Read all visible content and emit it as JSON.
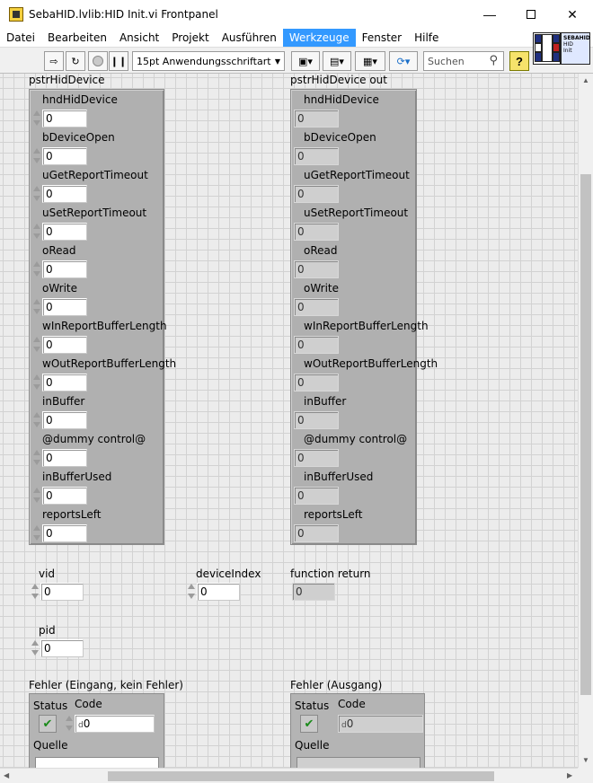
{
  "window": {
    "title": "SebaHID.lvlib:HID Init.vi Frontpanel"
  },
  "menu": [
    "Datei",
    "Bearbeiten",
    "Ansicht",
    "Projekt",
    "Ausführen",
    "Werkzeuge",
    "Fenster",
    "Hilfe"
  ],
  "menu_active_index": 5,
  "toolbar": {
    "font": "15pt Anwendungsschriftart",
    "search_placeholder": "Suchen",
    "help": "?"
  },
  "vi_icon": {
    "label_line1": "SEBAHID",
    "label_line2": "HID",
    "label_line3": "Init"
  },
  "input_cluster": {
    "label": "pstrHidDevice",
    "fields": [
      {
        "name": "hndHidDevice",
        "value": "0"
      },
      {
        "name": "bDeviceOpen",
        "value": "0"
      },
      {
        "name": "uGetReportTimeout",
        "value": "0"
      },
      {
        "name": "uSetReportTimeout",
        "value": "0"
      },
      {
        "name": "oRead",
        "value": "0"
      },
      {
        "name": "oWrite",
        "value": "0"
      },
      {
        "name": "wInReportBufferLength",
        "value": "0"
      },
      {
        "name": "wOutReportBufferLength",
        "value": "0"
      },
      {
        "name": "inBuffer",
        "value": "0"
      },
      {
        "name": "@dummy control@",
        "value": "0"
      },
      {
        "name": "inBufferUsed",
        "value": "0"
      },
      {
        "name": "reportsLeft",
        "value": "0"
      }
    ]
  },
  "output_cluster": {
    "label": "pstrHidDevice out",
    "fields": [
      {
        "name": "hndHidDevice",
        "value": "0"
      },
      {
        "name": "bDeviceOpen",
        "value": "0"
      },
      {
        "name": "uGetReportTimeout",
        "value": "0"
      },
      {
        "name": "uSetReportTimeout",
        "value": "0"
      },
      {
        "name": "oRead",
        "value": "0"
      },
      {
        "name": "oWrite",
        "value": "0"
      },
      {
        "name": "wInReportBufferLength",
        "value": "0"
      },
      {
        "name": "wOutReportBufferLength",
        "value": "0"
      },
      {
        "name": "inBuffer",
        "value": "0"
      },
      {
        "name": "@dummy control@",
        "value": "0"
      },
      {
        "name": "inBufferUsed",
        "value": "0"
      },
      {
        "name": "reportsLeft",
        "value": "0"
      }
    ]
  },
  "vid": {
    "label": "vid",
    "value": "0"
  },
  "pid": {
    "label": "pid",
    "value": "0"
  },
  "deviceIndex": {
    "label": "deviceIndex",
    "value": "0"
  },
  "function_return": {
    "label": "function return",
    "value": "0"
  },
  "error_in": {
    "label": "Fehler (Eingang, kein Fehler)",
    "status_label": "Status",
    "code_label": "Code",
    "code_value": "0",
    "source_label": "Quelle"
  },
  "error_out": {
    "label": "Fehler (Ausgang)",
    "status_label": "Status",
    "code_label": "Code",
    "code_value": "0",
    "source_label": "Quelle"
  }
}
